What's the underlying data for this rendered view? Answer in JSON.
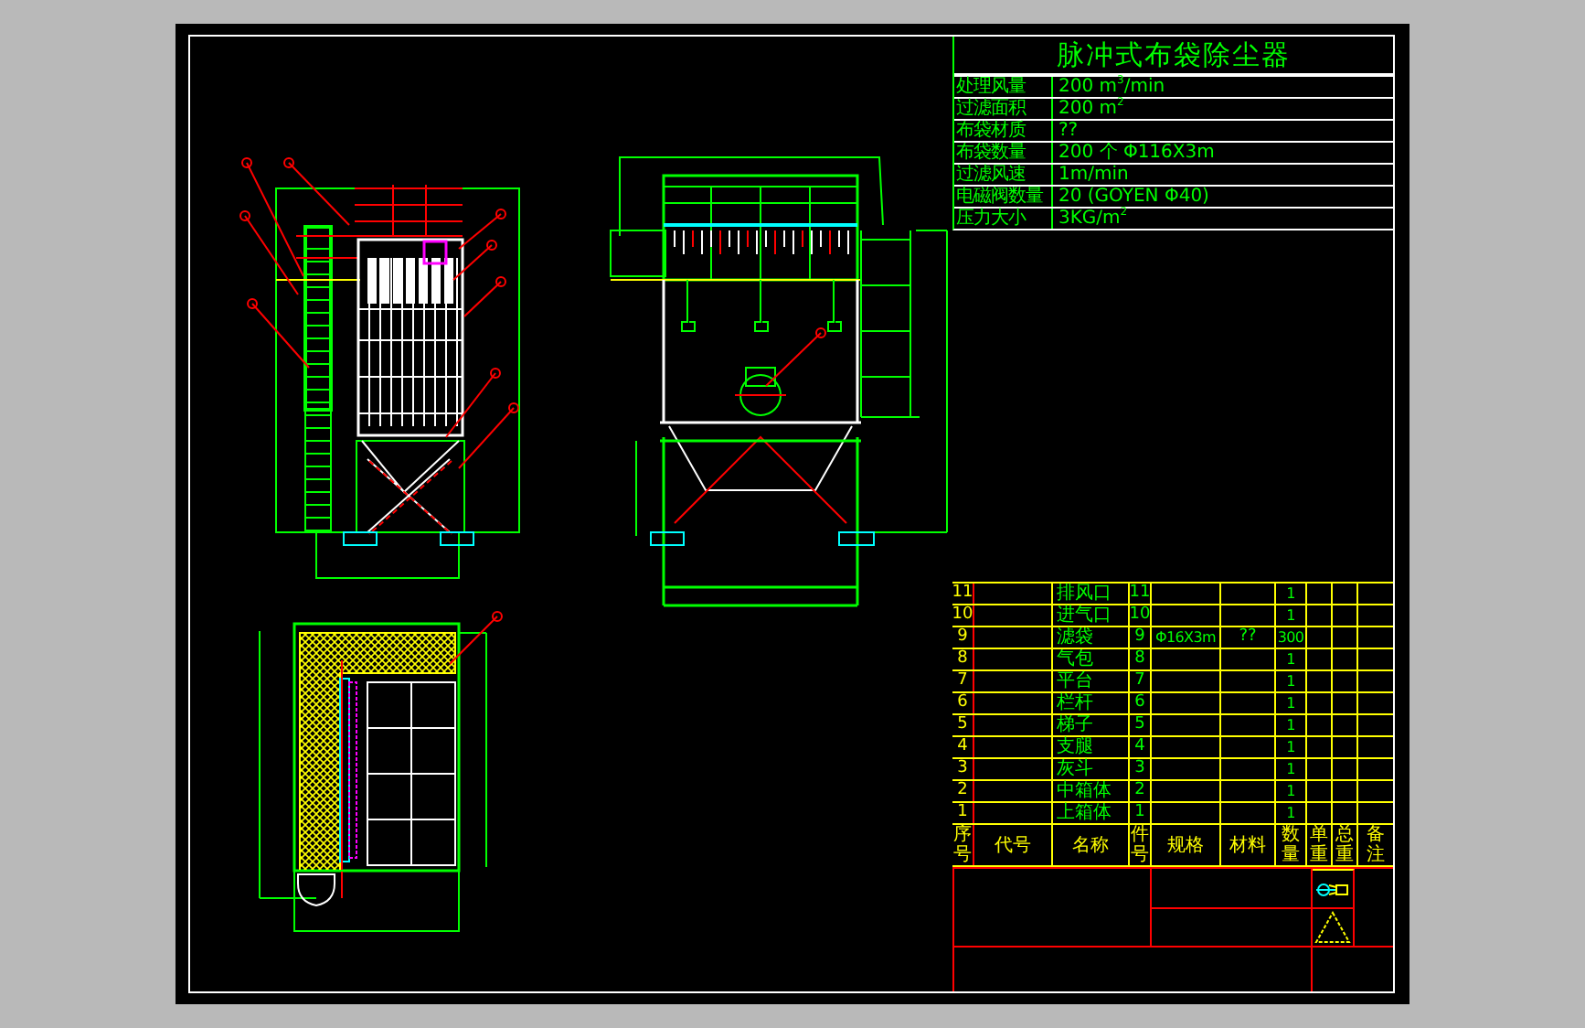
{
  "spec_sheet": {
    "title": "脉冲式布袋除尘器",
    "rows": [
      {
        "label": "处理风量",
        "value": "200 m$^{3}$/min"
      },
      {
        "label": "过滤面积",
        "value": "200 m$^{2}$"
      },
      {
        "label": "布袋材质",
        "value": "??"
      },
      {
        "label": "布袋数量",
        "value": "200 个  Φ116X3m"
      },
      {
        "label": "过滤风速",
        "value": "1m/min"
      },
      {
        "label": "电磁阀数量",
        "value": "20  (GOYEN Φ40)"
      },
      {
        "label": "压力大小",
        "value": "3KG/m$^{2}$"
      }
    ]
  },
  "parts_list": {
    "columns": [
      "序号",
      "代号",
      "名称",
      "件号",
      "规格",
      "材料",
      "数量",
      "单重",
      "总重",
      "备注"
    ],
    "rows": [
      {
        "no": "11",
        "name": "排风口",
        "part_no": "11",
        "qty": "1"
      },
      {
        "no": "10",
        "name": "进气口",
        "part_no": "10",
        "qty": "1"
      },
      {
        "no": "9",
        "name": "滤袋",
        "part_no": "9",
        "spec": "Φ16X3m",
        "material": "??",
        "qty": "300"
      },
      {
        "no": "8",
        "name": "气包",
        "part_no": "8",
        "qty": "1"
      },
      {
        "no": "7",
        "name": "平台",
        "part_no": "7",
        "qty": "1"
      },
      {
        "no": "6",
        "name": "栏杆",
        "part_no": "6",
        "qty": "1"
      },
      {
        "no": "5",
        "name": "梯子",
        "part_no": "5",
        "qty": "1"
      },
      {
        "no": "4",
        "name": "支腿",
        "part_no": "4",
        "qty": "1"
      },
      {
        "no": "3",
        "name": "灰斗",
        "part_no": "3",
        "qty": "1"
      },
      {
        "no": "2",
        "name": "中箱体",
        "part_no": "2",
        "qty": "1"
      },
      {
        "no": "1",
        "name": "上箱体",
        "part_no": "1",
        "qty": "1"
      }
    ]
  }
}
